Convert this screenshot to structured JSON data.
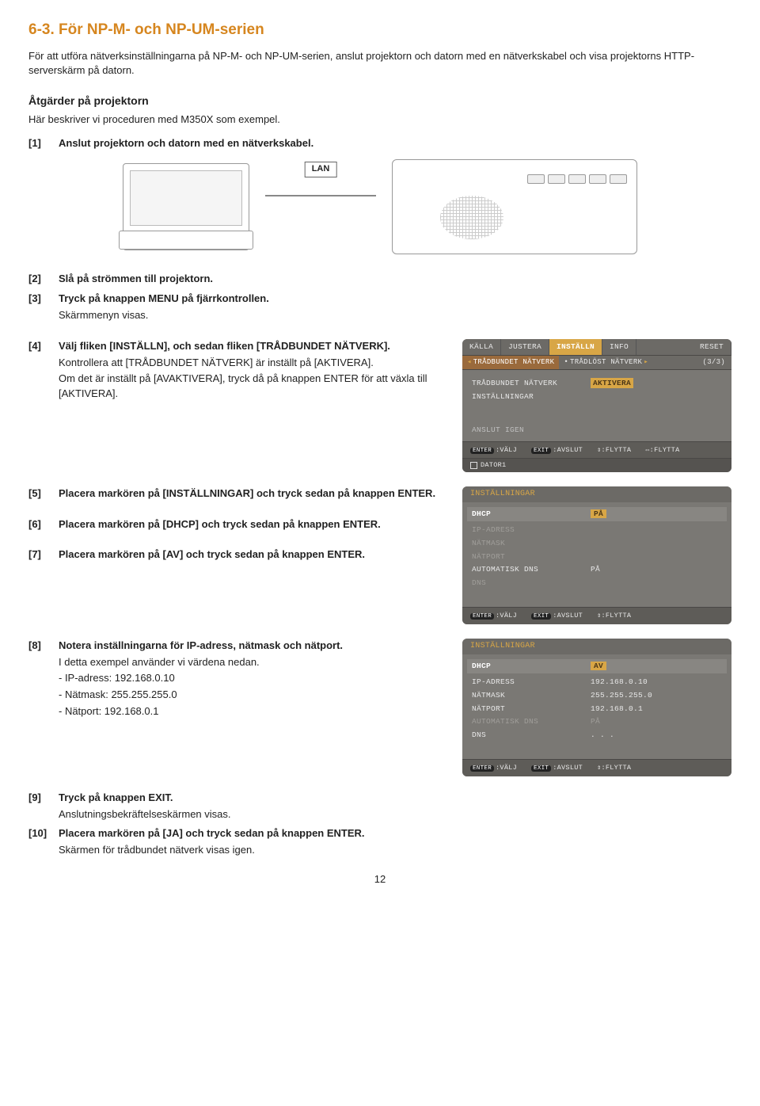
{
  "section_title": "6-3. För NP-M- och NP-UM-serien",
  "intro": "För att utföra nätverksinställningarna på NP-M- och NP-UM-serien, anslut projektorn och datorn med en nätverkskabel och visa projektorns HTTP-serverskärm på datorn.",
  "sub_heading": "Åtgärder på projektorn",
  "proc_desc": "Här beskriver vi proceduren med M350X som exempel.",
  "steps": {
    "s1": {
      "no": "[1]",
      "txt": "Anslut projektorn och datorn med en nätverkskabel."
    },
    "s2": {
      "no": "[2]",
      "txt": "Slå på strömmen till projektorn."
    },
    "s3": {
      "no": "[3]",
      "txt": "Tryck på knappen MENU på fjärrkontrollen.",
      "note": "Skärmmenyn visas."
    },
    "s4": {
      "no": "[4]",
      "txt": "Välj fliken [INSTÄLLN], och sedan fliken [TRÅDBUNDET NÄTVERK].",
      "n1": "Kontrollera att [TRÅDBUNDET NÄTVERK] är inställt på [AKTIVERA].",
      "n2": "Om det är inställt på [AVAKTIVERA], tryck då på knappen ENTER för att växla till [AKTIVERA]."
    },
    "s5": {
      "no": "[5]",
      "txt": "Placera markören på [INSTÄLLNINGAR] och tryck sedan på knappen ENTER."
    },
    "s6": {
      "no": "[6]",
      "txt": "Placera markören på [DHCP] och tryck sedan på knappen ENTER."
    },
    "s7": {
      "no": "[7]",
      "txt": "Placera markören på [AV] och tryck sedan på knappen ENTER."
    },
    "s8": {
      "no": "[8]",
      "txt": "Notera inställningarna för IP-adress, nätmask och nätport.",
      "n1": "I detta exempel använder vi värdena nedan.",
      "n2": "- IP-adress: 192.168.0.10",
      "n3": "- Nätmask: 255.255.255.0",
      "n4": "- Nätport: 192.168.0.1"
    },
    "s9": {
      "no": "[9]",
      "txt": "Tryck på knappen EXIT.",
      "note": "Anslutningsbekräftelseskärmen visas."
    },
    "s10": {
      "no": "[10]",
      "txt": "Placera markören på [JA] och tryck sedan på knappen ENTER.",
      "note": "Skärmen för trådbundet nätverk visas igen."
    }
  },
  "lan_label": "LAN",
  "osd1": {
    "tabs": [
      "KÄLLA",
      "JUSTERA",
      "INSTÄLLN",
      "INFO",
      "RESET"
    ],
    "active_tab": "INSTÄLLN",
    "subtabs": {
      "wired": "TRÅDBUNDET NÄTVERK",
      "wireless": "TRÅDLÖST NÄTVERK",
      "page": "3/3"
    },
    "rows": {
      "r1": {
        "l": "TRÅDBUNDET NÄTVERK",
        "v": "AKTIVERA"
      },
      "r2": {
        "l": "INSTÄLLNINGAR",
        "v": ""
      }
    },
    "anslut": "ANSLUT IGEN",
    "footer": {
      "enter": "ENTER",
      "valj": ":VÄLJ",
      "exit": "EXIT",
      "avslut": ":AVSLUT",
      "flytta1": "⇕:FLYTTA",
      "flytta2": "⇔:FLYTTA"
    },
    "source": "DATOR1"
  },
  "osd2": {
    "title": "INSTÄLLNINGAR",
    "rows": {
      "dhcp": {
        "l": "DHCP",
        "v": "PÅ"
      },
      "ip": {
        "l": "IP-ADRESS",
        "v": ""
      },
      "mask": {
        "l": "NÄTMASK",
        "v": ""
      },
      "gate": {
        "l": "NÄTPORT",
        "v": ""
      },
      "auto": {
        "l": "AUTOMATISK DNS",
        "v": "PÅ"
      },
      "dns": {
        "l": "DNS",
        "v": ""
      }
    },
    "footer": {
      "enter": "ENTER",
      "valj": ":VÄLJ",
      "exit": "EXIT",
      "avslut": ":AVSLUT",
      "flytta": "⇕:FLYTTA"
    }
  },
  "osd3": {
    "title": "INSTÄLLNINGAR",
    "rows": {
      "dhcp": {
        "l": "DHCP",
        "v": "AV"
      },
      "ip": {
        "l": "IP-ADRESS",
        "v": "192.168.0.10"
      },
      "mask": {
        "l": "NÄTMASK",
        "v": "255.255.255.0"
      },
      "gate": {
        "l": "NÄTPORT",
        "v": "192.168.0.1"
      },
      "auto": {
        "l": "AUTOMATISK DNS",
        "v": "PÅ"
      },
      "dns": {
        "l": "DNS",
        "v": ". . ."
      }
    },
    "footer": {
      "enter": "ENTER",
      "valj": ":VÄLJ",
      "exit": "EXIT",
      "avslut": ":AVSLUT",
      "flytta": "⇕:FLYTTA"
    }
  },
  "page_no": "12"
}
